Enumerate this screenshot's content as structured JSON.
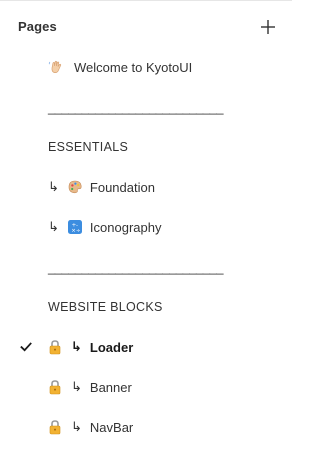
{
  "header": {
    "title": "Pages",
    "add_icon": "plus-icon"
  },
  "pages": [
    {
      "kind": "page",
      "label": "Welcome to KyotoUI",
      "icon": "waving-hand-icon"
    },
    {
      "kind": "divider",
      "label": "__________________________"
    },
    {
      "kind": "section",
      "label": "ESSENTIALS"
    },
    {
      "kind": "subpage",
      "prefix": "↳",
      "icon": "artist-palette-icon",
      "label": "Foundation"
    },
    {
      "kind": "subpage",
      "prefix": "↳",
      "icon": "symbols-icon",
      "label": "Iconography"
    },
    {
      "kind": "divider",
      "label": "__________________________"
    },
    {
      "kind": "section",
      "label": "WEBSITE BLOCKS"
    },
    {
      "kind": "locked-subpage",
      "lock_icon": "lock-icon",
      "prefix": "↳",
      "label": "Loader",
      "selected": true
    },
    {
      "kind": "locked-subpage",
      "lock_icon": "lock-icon",
      "prefix": "↳",
      "label": "Banner",
      "selected": false
    },
    {
      "kind": "locked-subpage",
      "lock_icon": "lock-icon",
      "prefix": "↳",
      "label": "NavBar",
      "selected": false
    }
  ],
  "colors": {
    "text": "#333333",
    "border": "#e6e6e6",
    "lock_body": "#f2b233",
    "lock_shackle": "#9a9a9a"
  }
}
